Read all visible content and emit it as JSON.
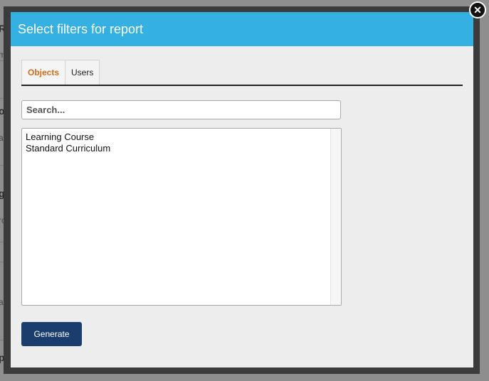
{
  "dialog": {
    "title": "Select filters for report",
    "close_icon": "close-icon"
  },
  "tabs": [
    {
      "label": "Objects",
      "active": true
    },
    {
      "label": "Users",
      "active": false
    }
  ],
  "search": {
    "placeholder": "Search...",
    "value": ""
  },
  "list": {
    "items": [
      "Learning Course",
      "Standard Curriculum"
    ]
  },
  "actions": {
    "generate_label": "Generate"
  },
  "colors": {
    "header": "#34b1e2",
    "active_tab": "#d06d19",
    "button": "#1b3d6e"
  },
  "background": {
    "fragments": [
      "Re",
      "m",
      "or",
      "ar",
      "g",
      "ro",
      "a",
      "p"
    ]
  }
}
